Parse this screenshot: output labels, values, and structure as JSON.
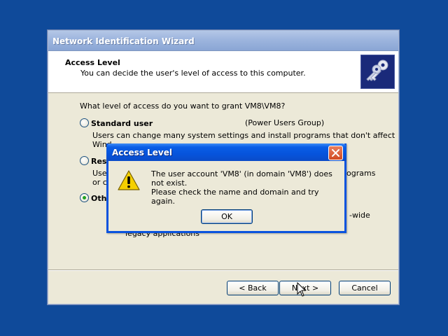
{
  "wizard": {
    "title": "Network Identification Wizard",
    "header_title": "Access Level",
    "header_subtitle": "You can decide the user's level of access to this computer.",
    "header_icon": "keys-icon",
    "question": "What level of access do you want to grant VM8\\VM8?",
    "options": [
      {
        "label": "Standard user",
        "group": "(Power Users Group)",
        "description_line1": "Users can change many system settings and install programs that don't affect",
        "description_line2": "Wind",
        "checked": false
      },
      {
        "label": "Rest",
        "description_line1": "User",
        "description_right": "ograms",
        "description_line2": "or ch",
        "checked": false
      },
      {
        "label": "Othe",
        "description_right": "-wide",
        "description_line2": "legacy applications",
        "checked": true
      }
    ],
    "buttons": {
      "back": "< Back",
      "next": "Next >",
      "cancel": "Cancel"
    }
  },
  "dialog": {
    "title": "Access Level",
    "icon": "warning-icon",
    "message_line1": "The user account 'VM8' (in domain 'VM8') does not exist.",
    "message_line2": "Please check the name and domain and try again.",
    "ok_label": "OK"
  },
  "colors": {
    "desktop": "#0f4a9a",
    "dialog_title_blue": "#0654dc",
    "window_face": "#ece9d8"
  }
}
